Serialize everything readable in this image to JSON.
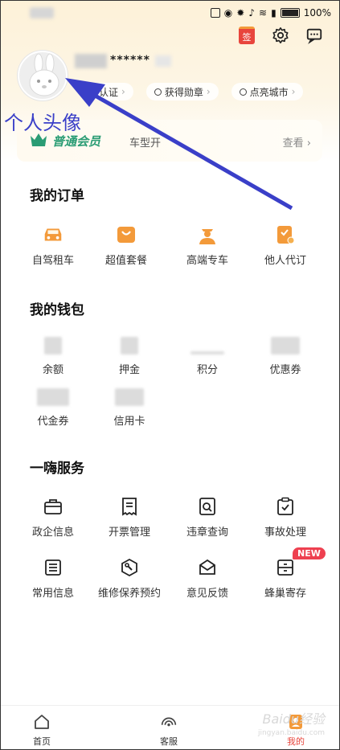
{
  "status_bar": {
    "battery": "100%"
  },
  "top_actions": {
    "sign_label": "签"
  },
  "profile": {
    "username": "******",
    "chips": [
      "认证",
      "获得勋章",
      "点亮城市"
    ]
  },
  "annotation": "个人头像",
  "member": {
    "title": "普通会员",
    "desc": "车型开",
    "link": "查看 ›"
  },
  "orders": {
    "title": "我的订单",
    "items": [
      {
        "label": "自驾租车",
        "icon": "car-icon"
      },
      {
        "label": "超值套餐",
        "icon": "shopping-bag-icon"
      },
      {
        "label": "高端专车",
        "icon": "driver-icon"
      },
      {
        "label": "他人代订",
        "icon": "proxy-order-icon"
      }
    ]
  },
  "wallet": {
    "title": "我的钱包",
    "items": [
      {
        "label": "余额"
      },
      {
        "label": "押金"
      },
      {
        "label": "积分"
      },
      {
        "label": "优惠券"
      },
      {
        "label": "代金券"
      },
      {
        "label": "信用卡"
      }
    ]
  },
  "services": {
    "title": "一嗨服务",
    "items": [
      {
        "label": "政企信息",
        "icon": "briefcase-icon"
      },
      {
        "label": "开票管理",
        "icon": "invoice-icon"
      },
      {
        "label": "违章查询",
        "icon": "violation-search-icon"
      },
      {
        "label": "事故处理",
        "icon": "clipboard-check-icon"
      },
      {
        "label": "常用信息",
        "icon": "list-icon"
      },
      {
        "label": "维修保养预约",
        "icon": "wrench-icon"
      },
      {
        "label": "意见反馈",
        "icon": "feedback-icon"
      },
      {
        "label": "蜂巢寄存",
        "icon": "locker-icon"
      }
    ],
    "new_badge": "NEW"
  },
  "tabbar": {
    "items": [
      {
        "label": "首页",
        "icon": "home-icon"
      },
      {
        "label": "客服",
        "icon": "customer-service-icon"
      },
      {
        "label": "我的",
        "icon": "profile-icon"
      }
    ]
  },
  "watermark": {
    "text": "Baidu经验",
    "sub": "jingyan.baidu.com"
  },
  "colors": {
    "accent": "#e8453c",
    "orange": "#f39a3a",
    "member_green": "#2a9c74",
    "annotation_blue": "#3a3fc8"
  }
}
